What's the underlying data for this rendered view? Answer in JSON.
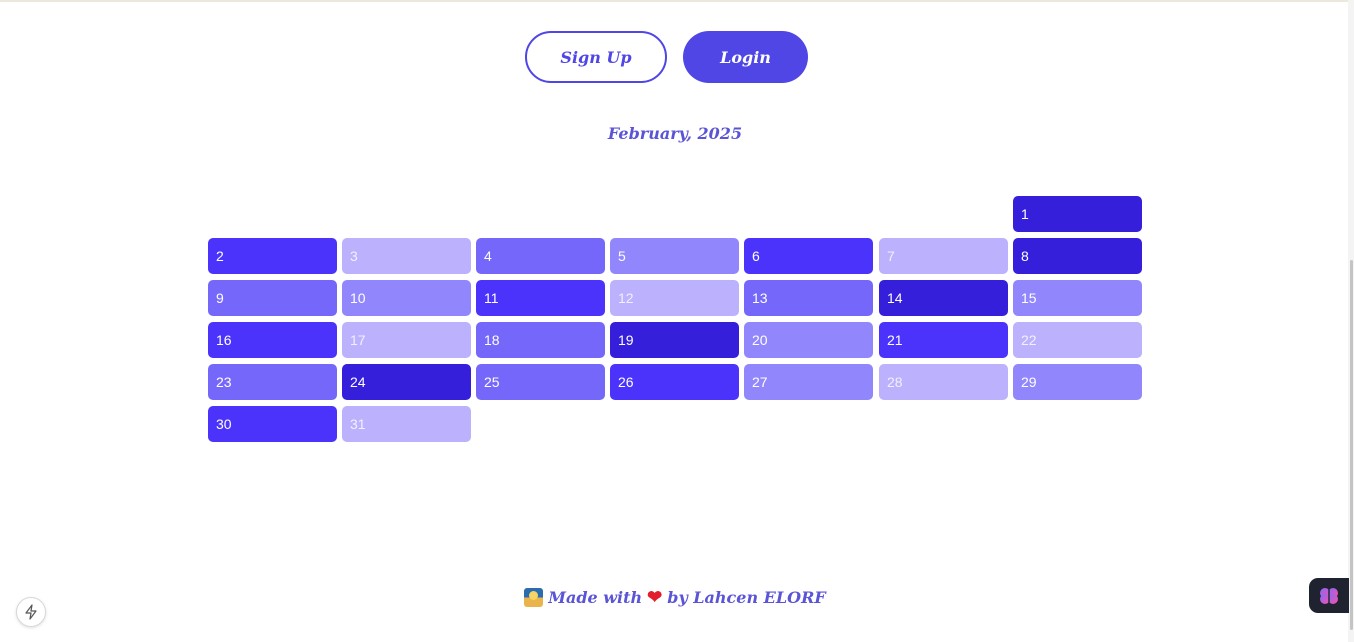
{
  "auth": {
    "signup_label": "Sign Up",
    "login_label": "Login"
  },
  "calendar": {
    "title": "February, 2025",
    "days": [
      "1",
      "2",
      "3",
      "4",
      "5",
      "6",
      "7",
      "8",
      "9",
      "10",
      "11",
      "12",
      "13",
      "14",
      "15",
      "16",
      "17",
      "18",
      "19",
      "20",
      "21",
      "22",
      "23",
      "24",
      "25",
      "26",
      "27",
      "28",
      "29",
      "30",
      "31"
    ]
  },
  "footer": {
    "made_with": "Made with",
    "by": "by Lahcen ELORF"
  },
  "icons": {
    "bolt": "lightning-bolt-icon",
    "brain": "brain-extension-icon",
    "sunrise": "sunrise-emoji-icon",
    "heart": "heart-icon"
  },
  "colors": {
    "accent": "#4f46e5",
    "level_1": "#bbb1fc",
    "level_2": "#9186fb",
    "level_3": "#7567fa",
    "level_4": "#4b33fc",
    "level_5": "#351fdb"
  }
}
